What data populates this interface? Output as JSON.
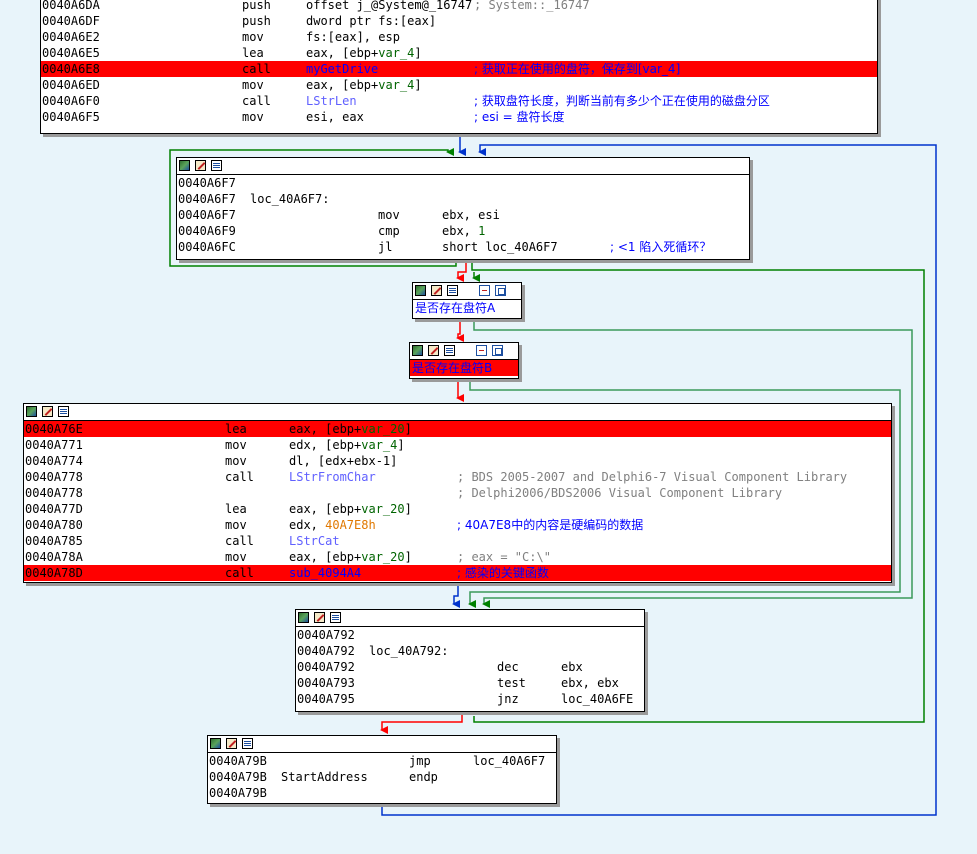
{
  "colors": {
    "background": "#e8f4fa",
    "highlight": "#ff0000",
    "edge_true": "#008000",
    "edge_false": "#ff0000",
    "edge_loop": "#0033cc"
  },
  "node1": {
    "rows": [
      {
        "addr": "0040A6DA",
        "mn": "push",
        "op": "offset j_@System@_16747",
        "cmt": "; System::_16747"
      },
      {
        "addr": "0040A6DF",
        "mn": "push",
        "op": "dword ptr fs:[eax]",
        "cmt": ""
      },
      {
        "addr": "0040A6E2",
        "mn": "mov",
        "op": "fs:[eax], esp",
        "cmt": ""
      },
      {
        "addr": "0040A6E5",
        "mn": "lea",
        "op_pre": "eax, [ebp+",
        "op_var": "var_4",
        "op_post": "]"
      },
      {
        "addr": "0040A6E8",
        "mn": "call",
        "fn": "myGetDrive",
        "cmt": "; 获取正在使用的盘符，保存到[var_4]"
      },
      {
        "addr": "0040A6ED",
        "mn": "mov",
        "op_pre": "eax, [ebp+",
        "op_var": "var_4",
        "op_post": "]"
      },
      {
        "addr": "0040A6F0",
        "mn": "call",
        "fn": "LStrLen",
        "cmt": "; 获取盘符长度，判断当前有多少个正在使用的磁盘分区"
      },
      {
        "addr": "0040A6F5",
        "mn": "mov",
        "op": "esi, eax",
        "cmt": "; esi = 盘符长度"
      }
    ]
  },
  "node2": {
    "rows": [
      {
        "addr": "0040A6F7"
      },
      {
        "addr": "0040A6F7",
        "label": "loc_40A6F7:"
      },
      {
        "addr": "0040A6F7",
        "mn": "mov",
        "op": "ebx, esi"
      },
      {
        "addr": "0040A6F9",
        "mn": "cmp",
        "op_pre": "ebx, ",
        "op_num": "1"
      },
      {
        "addr": "0040A6FC",
        "mn": "jl",
        "op": "short loc_40A6F7",
        "cmt": "; <1 陷入死循环？"
      }
    ]
  },
  "node3": {
    "text": "是否存在盘符A"
  },
  "node4": {
    "text": "是否存在盘符B"
  },
  "node5": {
    "rows": [
      {
        "addr": "0040A76E",
        "mn": "lea",
        "op_pre": "eax, [ebp+",
        "op_var": "var_20",
        "op_post": "]"
      },
      {
        "addr": "0040A771",
        "mn": "mov",
        "op_pre": "edx, [ebp+",
        "op_var": "var_4",
        "op_post": "]"
      },
      {
        "addr": "0040A774",
        "mn": "mov",
        "op": "dl, [edx+ebx-1]"
      },
      {
        "addr": "0040A778",
        "mn": "call",
        "fn": "LStrFromChar",
        "cmt": "; BDS 2005-2007 and Delphi6-7 Visual Component Library"
      },
      {
        "addr": "0040A778",
        "cmt": "; Delphi2006/BDS2006 Visual Component Library"
      },
      {
        "addr": "0040A77D",
        "mn": "lea",
        "op_pre": "eax, [ebp+",
        "op_var": "var_20",
        "op_post": "]"
      },
      {
        "addr": "0040A780",
        "mn": "mov",
        "op_pre": "edx, ",
        "op_orange": "40A7E8h",
        "cmt": "; 40A7E8中的内容是硬编码的数据"
      },
      {
        "addr": "0040A785",
        "mn": "call",
        "fn": "LStrCat"
      },
      {
        "addr": "0040A78A",
        "mn": "mov",
        "op_pre": "eax, [ebp+",
        "op_var": "var_20",
        "op_post": "]",
        "cmt": "; eax = \"C:\\\""
      },
      {
        "addr": "0040A78D",
        "mn": "call",
        "fn": "sub_4094A4",
        "cmt": "; 感染的关键函数"
      }
    ]
  },
  "node6": {
    "rows": [
      {
        "addr": "0040A792"
      },
      {
        "addr": "0040A792",
        "label": "loc_40A792:"
      },
      {
        "addr": "0040A792",
        "mn": "dec",
        "op": "ebx"
      },
      {
        "addr": "0040A793",
        "mn": "test",
        "op": "ebx, ebx"
      },
      {
        "addr": "0040A795",
        "mn": "jnz",
        "op": "loc_40A6FE"
      }
    ]
  },
  "node7": {
    "rows": [
      {
        "addr": "0040A79B",
        "mn": "jmp",
        "op": "loc_40A6F7"
      },
      {
        "addr": "0040A79B",
        "label": "StartAddress",
        "mn": "endp"
      },
      {
        "addr": "0040A79B"
      }
    ]
  }
}
